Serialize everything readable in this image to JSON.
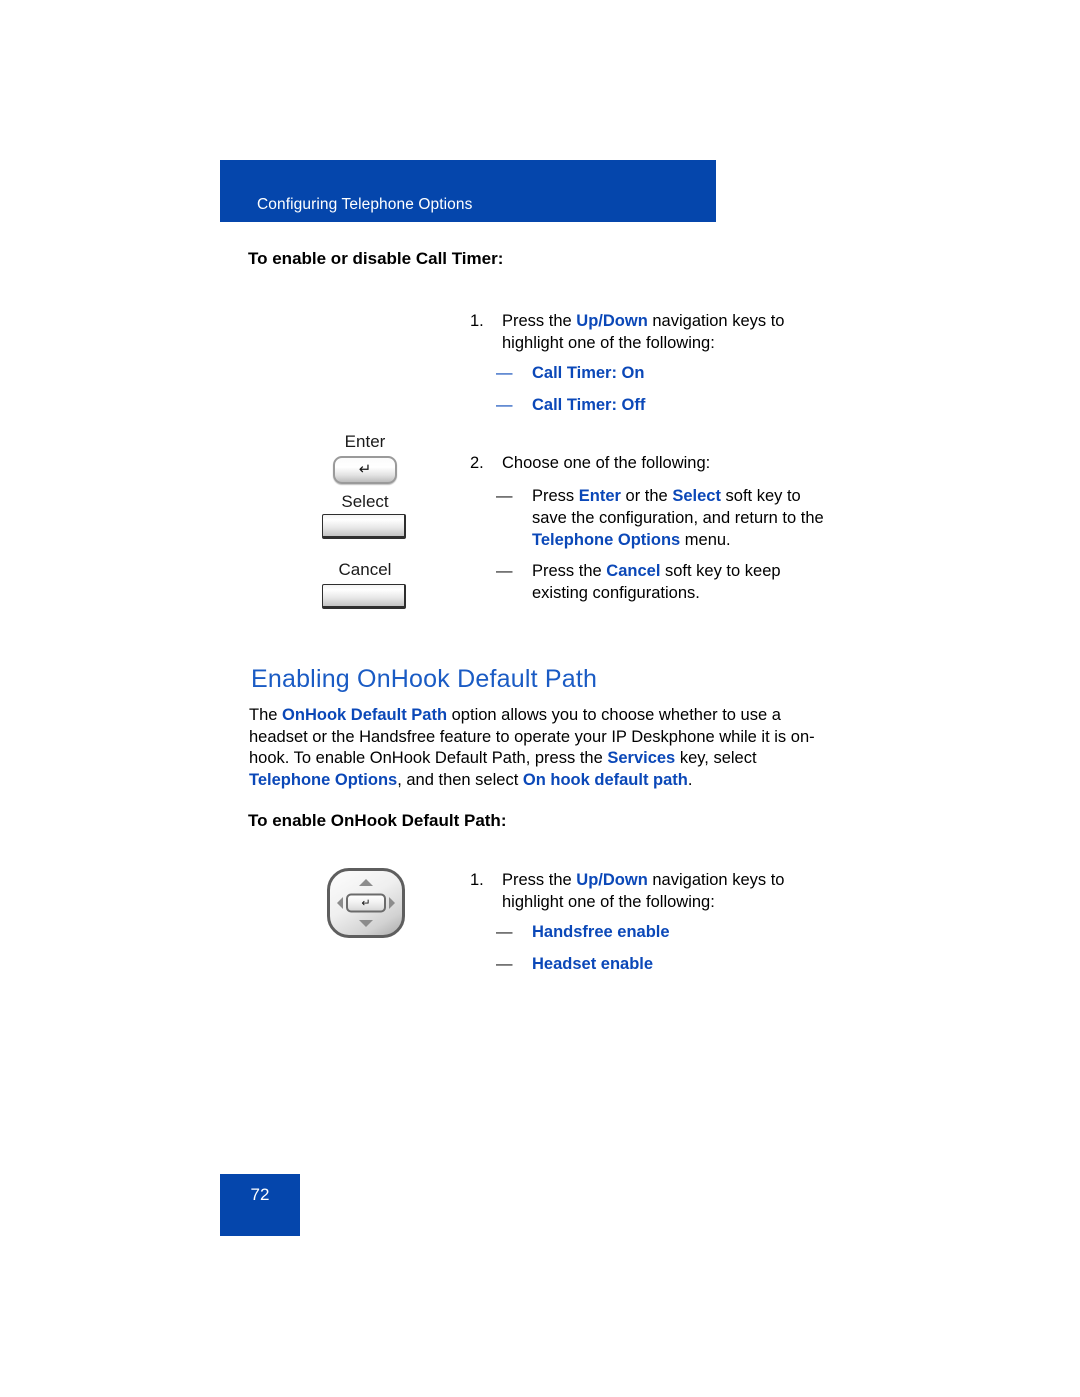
{
  "header": {
    "chapter_title": "Configuring Telephone Options",
    "banner_color": "#0546AC"
  },
  "colors": {
    "banner_blue": "#0546AC",
    "heading_blue": "#1A5BC4",
    "keyword_blue": "#0B48B8",
    "body_black": "#000000"
  },
  "call_timer_section": {
    "subheading": "To enable or disable Call Timer:",
    "step1": {
      "number": "1.",
      "text_before": "Press the ",
      "keyword": "Up/Down",
      "text_after": " navigation keys to highlight one of the following:"
    },
    "step1_options": [
      {
        "dash": "—",
        "label": "Call Timer: On"
      },
      {
        "dash": "—",
        "label": "Call Timer: Off"
      }
    ],
    "step2": {
      "number": "2.",
      "text": "Choose one of the following:"
    },
    "step2_options": [
      {
        "dash": "—",
        "part1": "Press ",
        "kw1": "Enter",
        "part2": " or the ",
        "kw2": "Select",
        "part3": " soft key to save the configuration, and return to the ",
        "kw3": "Telephone Options",
        "part4": " menu."
      },
      {
        "dash": "—",
        "part1": "Press the ",
        "kw1": "Cancel",
        "part2": " soft key to keep existing configurations."
      }
    ],
    "keys": [
      {
        "label": "Enter",
        "icon": "enter-key-icon",
        "glyph": "↵"
      },
      {
        "label": "Select",
        "icon": "soft-key-icon"
      },
      {
        "label": "Cancel",
        "icon": "soft-key-icon"
      }
    ]
  },
  "onhook_section": {
    "heading": "Enabling OnHook Default Path",
    "paragraph": {
      "p1": "The ",
      "kw1": "OnHook Default Path",
      "p2": " option allows you to choose whether to use a headset or the Handsfree feature to operate your IP Deskphone while it is on-hook. To enable OnHook Default Path, press the ",
      "kw2": "Services",
      "p3": " key, select ",
      "kw3": "Telephone Options",
      "p4": ", and then select ",
      "kw4": "On hook default path",
      "p5": "."
    },
    "subheading": "To enable OnHook Default Path:",
    "step1": {
      "number": "1.",
      "text_before": "Press the ",
      "keyword": "Up/Down",
      "text_after": " navigation keys to highlight one of the following:"
    },
    "step1_options": [
      {
        "dash": "—",
        "label": "Handsfree enable"
      },
      {
        "dash": "—",
        "label": "Headset enable"
      }
    ],
    "nav_key": {
      "icon": "navigation-cluster-icon",
      "center_glyph": "↵"
    }
  },
  "footer": {
    "page_number": "72"
  }
}
